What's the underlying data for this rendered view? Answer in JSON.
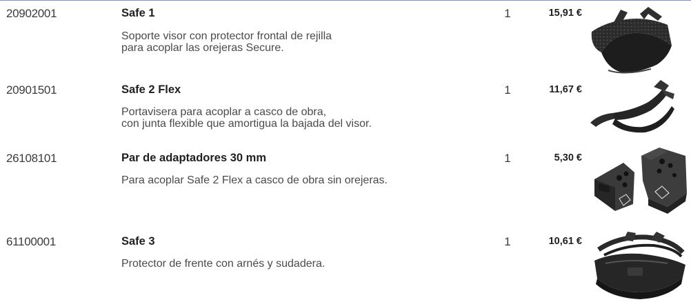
{
  "products": [
    {
      "code": "20902001",
      "name": "Safe 1",
      "desc_line1": "Soporte visor con protector frontal de rejilla",
      "desc_line2": "para acoplar las orejeras Secure.",
      "qty": "1",
      "price": "15,91 €",
      "image": "visor-mesh-guard-image"
    },
    {
      "code": "20901501",
      "name": "Safe 2 Flex",
      "desc_line1": "Portavisera para acoplar a casco de obra,",
      "desc_line2": "con junta flexible que amortigua la bajada del visor.",
      "qty": "1",
      "price": "11,67 €",
      "image": "visor-holder-image"
    },
    {
      "code": "26108101",
      "name": "Par de adaptadores 30 mm",
      "desc_line1": "Para acoplar Safe 2 Flex a casco de obra sin orejeras.",
      "desc_line2": "",
      "qty": "1",
      "price": "5,30 €",
      "image": "adapters-pair-image"
    },
    {
      "code": "61100001",
      "name": "Safe 3",
      "desc_line1": "Protector de frente con arnés y sudadera.",
      "desc_line2": "",
      "qty": "1",
      "price": "10,61 €",
      "image": "headgear-harness-image"
    }
  ],
  "colors": {
    "rule": "#8d8fb8",
    "text": "#2a2a2a",
    "product_dark": "#262626"
  }
}
